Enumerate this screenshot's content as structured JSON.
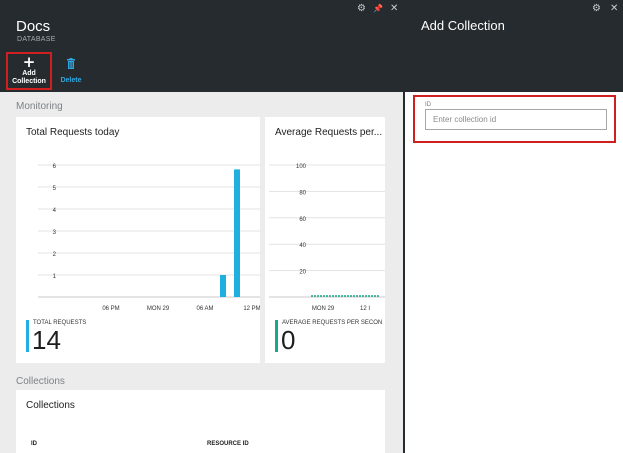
{
  "left_blade": {
    "title": "Docs",
    "subtitle": "DATABASE",
    "controls": {
      "settings": "⚙",
      "pin": "📌",
      "close": "✕"
    },
    "commands": {
      "add_collection": "Add\nCollection",
      "delete": "Delete"
    },
    "monitoring_title": "Monitoring",
    "collections_title": "Collections",
    "collections_tile": {
      "title": "Collections",
      "columns": [
        "ID",
        "RESOURCE ID"
      ]
    }
  },
  "tiles": {
    "total_requests": {
      "title": "Total Requests today",
      "kpi_label": "TOTAL REQUESTS",
      "kpi_value": "14",
      "kpi_color": "#1fb0e0"
    },
    "avg_requests": {
      "title": "Average Requests per...",
      "kpi_label": "AVERAGE REQUESTS PER SECON",
      "kpi_value": "0",
      "kpi_color": "#1aa88a"
    }
  },
  "chart_data": [
    {
      "type": "bar",
      "y_ticks": [
        "6",
        "5",
        "4",
        "3",
        "2",
        "1"
      ],
      "x_ticks": [
        "06 PM",
        "MON 29",
        "06 AM",
        "12 PM"
      ],
      "ylim": [
        0,
        6
      ],
      "grid": true,
      "color": "#1fb0e0",
      "series": [
        {
          "values": [
            1,
            5.8
          ]
        }
      ]
    },
    {
      "type": "area",
      "y_ticks": [
        "100",
        "80",
        "60",
        "40",
        "20"
      ],
      "x_ticks": [
        "MON 29",
        "12 I"
      ],
      "ylim": [
        0,
        100
      ],
      "grid": true,
      "color": "#1aa88a",
      "series": [
        {
          "values": [
            0,
            0,
            0,
            0,
            0,
            0,
            0,
            0,
            0,
            0,
            0,
            0,
            0,
            0,
            0,
            0,
            0,
            0,
            0,
            0
          ]
        }
      ]
    }
  ],
  "right_blade": {
    "title": "Add Collection",
    "controls": {
      "settings": "⚙",
      "close": "✕"
    },
    "id_label": "ID",
    "id_placeholder": "Enter collection id"
  }
}
